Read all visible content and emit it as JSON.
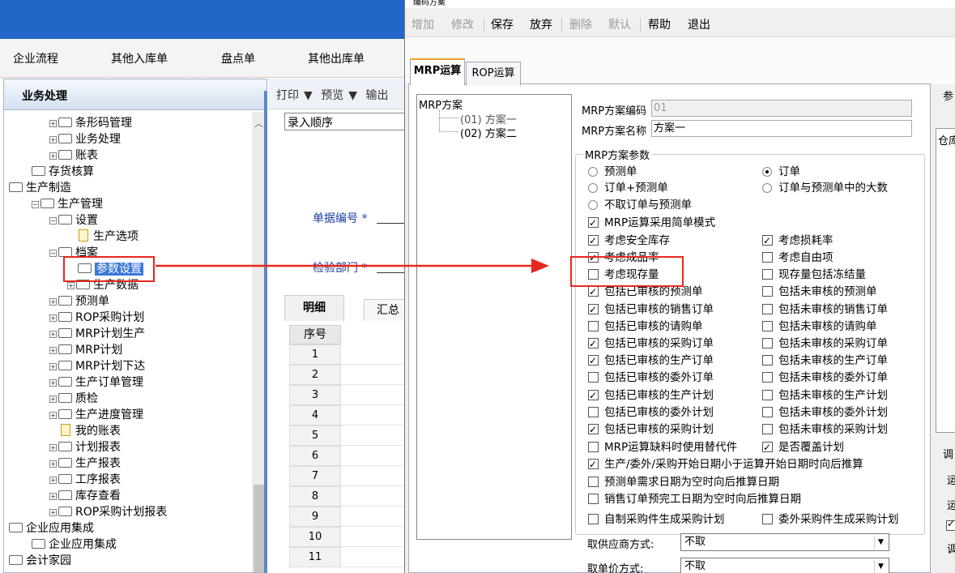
{
  "dialog_title": "编码方案",
  "menubar": [
    "企业流程",
    "其他入库单",
    "盘点单",
    "其他出库单"
  ],
  "left_panel": {
    "title": "业务处理",
    "tree": [
      {
        "label": "条形码管理",
        "kind": "folder-exp"
      },
      {
        "label": "业务处理",
        "kind": "folder-exp"
      },
      {
        "label": "账表",
        "kind": "folder-exp"
      },
      {
        "label": "存货核算",
        "kind": "folder"
      },
      {
        "label": "生产制造",
        "kind": "root"
      },
      {
        "label": "生产管理",
        "kind": "folder-exp-open"
      },
      {
        "label": "设置",
        "kind": "folder-exp-open"
      },
      {
        "label": "生产选项",
        "kind": "page"
      },
      {
        "label": "档案",
        "kind": "folder-exp-open"
      },
      {
        "label": "参数设置",
        "kind": "folder-selected"
      },
      {
        "label": "生产数据",
        "kind": "folder-exp"
      },
      {
        "label": "预测单",
        "kind": "folder-exp"
      },
      {
        "label": "ROP采购计划",
        "kind": "folder-exp"
      },
      {
        "label": "MRP计划生产",
        "kind": "folder-exp"
      },
      {
        "label": "MRP计划",
        "kind": "folder-exp"
      },
      {
        "label": "MRP计划下达",
        "kind": "folder-exp"
      },
      {
        "label": "生产订单管理",
        "kind": "folder-exp"
      },
      {
        "label": "质检",
        "kind": "folder-exp"
      },
      {
        "label": "生产进度管理",
        "kind": "folder-exp"
      },
      {
        "label": "我的账表",
        "kind": "page"
      },
      {
        "label": "计划报表",
        "kind": "folder-exp"
      },
      {
        "label": "生产报表",
        "kind": "folder-exp"
      },
      {
        "label": "工序报表",
        "kind": "folder-exp"
      },
      {
        "label": "库存查看",
        "kind": "folder-exp"
      },
      {
        "label": "ROP采购计划报表",
        "kind": "folder-exp"
      },
      {
        "label": "企业应用集成",
        "kind": "root"
      },
      {
        "label": "企业应用集成",
        "kind": "folder"
      },
      {
        "label": "会计家园",
        "kind": "root"
      }
    ]
  },
  "middle_panel": {
    "toolbar": {
      "print": "打印",
      "preview": "预览",
      "export": "输出"
    },
    "order_value": "录入顺序",
    "doc_no_label": "单据编号 *",
    "inspect_dept_label": "检验部门 *",
    "tab_detail": "明细",
    "tab_summary": "汇总",
    "grid_header": "序号",
    "rows": [
      "1",
      "2",
      "3",
      "4",
      "5",
      "6",
      "7",
      "8",
      "9",
      "10",
      "11"
    ]
  },
  "dialog": {
    "toolbar": [
      {
        "label": "增加",
        "enabled": false
      },
      {
        "label": "修改",
        "enabled": false
      },
      {
        "label": "保存",
        "enabled": true
      },
      {
        "label": "放弃",
        "enabled": true
      },
      {
        "label": "删除",
        "enabled": false
      },
      {
        "label": "默认",
        "enabled": false
      },
      {
        "label": "帮助",
        "enabled": true
      },
      {
        "label": "退出",
        "enabled": true
      }
    ],
    "tabs": {
      "mrp": "MRP运算",
      "rop": "ROP运算"
    },
    "scheme_tree": {
      "root": "MRP方案",
      "item1": "(01) 方案一",
      "item2": "(02) 方案二"
    },
    "code_label": "MRP方案编码",
    "code_value": "01",
    "name_label": "MRP方案名称",
    "name_value": "方案一",
    "params_legend": "MRP方案参数",
    "radios": {
      "forecast": {
        "label": "预测单",
        "checked": false
      },
      "order": {
        "label": "订单",
        "checked": true
      },
      "order_plus_forecast": {
        "label": "订单+预测单",
        "checked": false
      },
      "order_or_forecast_max": {
        "label": "订单与预测单中的大数",
        "checked": false
      },
      "none": {
        "label": "不取订单与预测单",
        "checked": false
      }
    },
    "checks": {
      "simple_mode": {
        "label": "MRP运算采用简单模式",
        "checked": true
      },
      "safety_stock": {
        "label": "考虑安全库存",
        "checked": true
      },
      "loss_rate": {
        "label": "考虑损耗率",
        "checked": true
      },
      "yield_rate": {
        "label": "考虑成品率",
        "checked": true
      },
      "free_item": {
        "label": "考虑自由项",
        "checked": false
      },
      "on_hand": {
        "label": "考虑现存量",
        "checked": false
      },
      "frozen": {
        "label": "现存量包括冻结量",
        "checked": false
      },
      "aud_forecast": {
        "label": "包括已审核的预测单",
        "checked": true
      },
      "unaud_forecast": {
        "label": "包括未审核的预测单",
        "checked": false
      },
      "aud_sales": {
        "label": "包括已审核的销售订单",
        "checked": true
      },
      "unaud_sales": {
        "label": "包括未审核的销售订单",
        "checked": false
      },
      "aud_req": {
        "label": "包括已审核的请购单",
        "checked": false
      },
      "unaud_req": {
        "label": "包括未审核的请购单",
        "checked": false
      },
      "aud_po": {
        "label": "包括已审核的采购订单",
        "checked": true
      },
      "unaud_po": {
        "label": "包括未审核的采购订单",
        "checked": false
      },
      "aud_mo": {
        "label": "包括已审核的生产订单",
        "checked": true
      },
      "unaud_mo": {
        "label": "包括未审核的生产订单",
        "checked": false
      },
      "aud_sub": {
        "label": "包括已审核的委外订单",
        "checked": false
      },
      "unaud_sub": {
        "label": "包括未审核的委外订单",
        "checked": false
      },
      "aud_prodplan": {
        "label": "包括已审核的生产计划",
        "checked": true
      },
      "unaud_prodplan": {
        "label": "包括未审核的生产计划",
        "checked": false
      },
      "aud_subplan": {
        "label": "包括已审核的委外计划",
        "checked": false
      },
      "unaud_subplan": {
        "label": "包括未审核的委外计划",
        "checked": false
      },
      "aud_purplan": {
        "label": "包括已审核的采购计划",
        "checked": true
      },
      "unaud_purplan": {
        "label": "包括未审核的采购计划",
        "checked": false
      },
      "substitute": {
        "label": "MRP运算缺料时使用替代件",
        "checked": false
      },
      "override": {
        "label": "是否覆盖计划",
        "checked": true
      },
      "start_date": {
        "label": "生产/委外/采购开始日期小于运算开始日期时向后推算",
        "checked": true
      },
      "forecast_date": {
        "label": "预测单需求日期为空时向后推算日期",
        "checked": false
      },
      "sales_date": {
        "label": "销售订单预完工日期为空时向后推算日期",
        "checked": false
      },
      "self_made": {
        "label": "自制采购件生成采购计划",
        "checked": false
      },
      "outsourced": {
        "label": "委外采购件生成采购计划",
        "checked": false
      }
    },
    "supplier_label": "取供应商方式:",
    "supplier_value": "不取",
    "price_label": "取单价方式:",
    "price_value": "不取",
    "right_cut": {
      "top": "参",
      "col": "仓库",
      "group": "调",
      "a": "运",
      "b": "运",
      "c": "调"
    }
  }
}
